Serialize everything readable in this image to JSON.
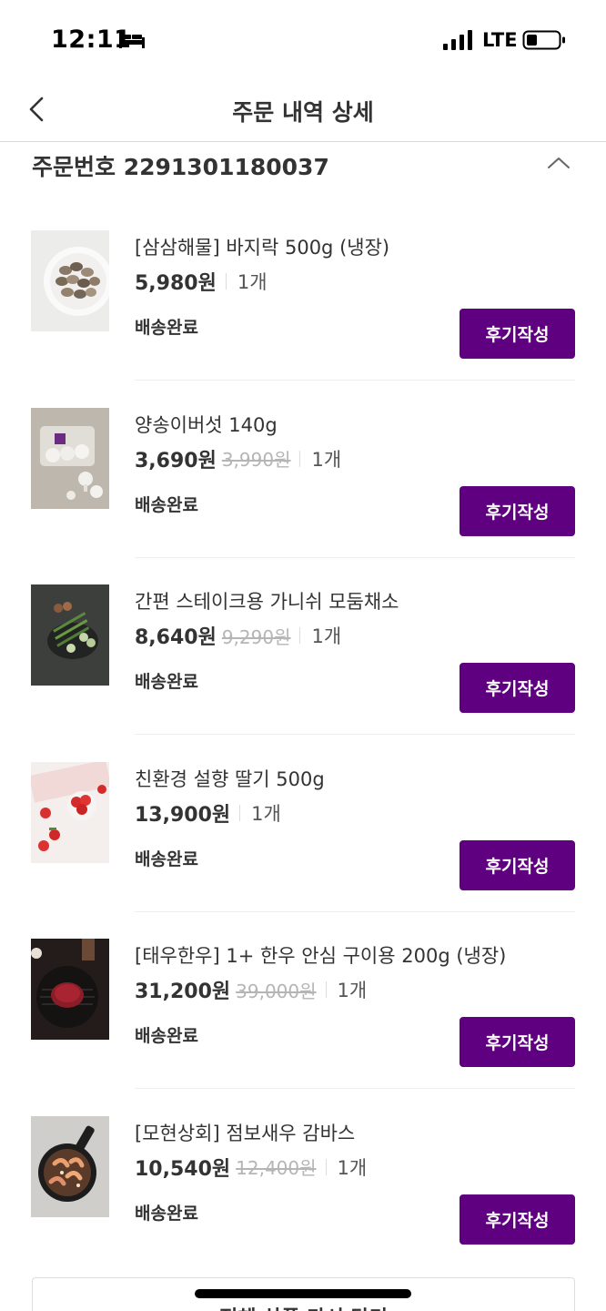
{
  "status_bar": {
    "time": "12:11",
    "network": "LTE",
    "icons": [
      "bed-icon",
      "signal-icon",
      "battery-icon"
    ]
  },
  "header": {
    "title": "주문 내역 상세",
    "back_icon": "chevron-left-icon"
  },
  "order": {
    "number_label": "주문번호 2291301180037",
    "collapse_icon": "chevron-up-icon"
  },
  "items": [
    {
      "name": "[삼삼해물] 바지락 500g (냉장)",
      "price": "5,980원",
      "original_price": "",
      "quantity": "1개",
      "status": "배송완료",
      "review_label": "후기작성"
    },
    {
      "name": "양송이버섯 140g",
      "price": "3,690원",
      "original_price": "3,990원",
      "quantity": "1개",
      "status": "배송완료",
      "review_label": "후기작성"
    },
    {
      "name": "간편 스테이크용 가니쉬 모둠채소",
      "price": "8,640원",
      "original_price": "9,290원",
      "quantity": "1개",
      "status": "배송완료",
      "review_label": "후기작성"
    },
    {
      "name": "친환경 설향 딸기 500g",
      "price": "13,900원",
      "original_price": "",
      "quantity": "1개",
      "status": "배송완료",
      "review_label": "후기작성"
    },
    {
      "name": "[태우한우] 1+ 한우 안심 구이용 200g (냉장)",
      "price": "31,200원",
      "original_price": "39,000원",
      "quantity": "1개",
      "status": "배송완료",
      "review_label": "후기작성"
    },
    {
      "name": "[모현상회] 점보새우 감바스",
      "price": "10,540원",
      "original_price": "12,400원",
      "quantity": "1개",
      "status": "배송완료",
      "review_label": "후기작성"
    }
  ],
  "bottom_button_label": "전체 상품 다시 담기",
  "colors": {
    "accent": "#5f0080",
    "text": "#333333",
    "strike": "#b5b5b5",
    "divider": "#eeeeee"
  }
}
